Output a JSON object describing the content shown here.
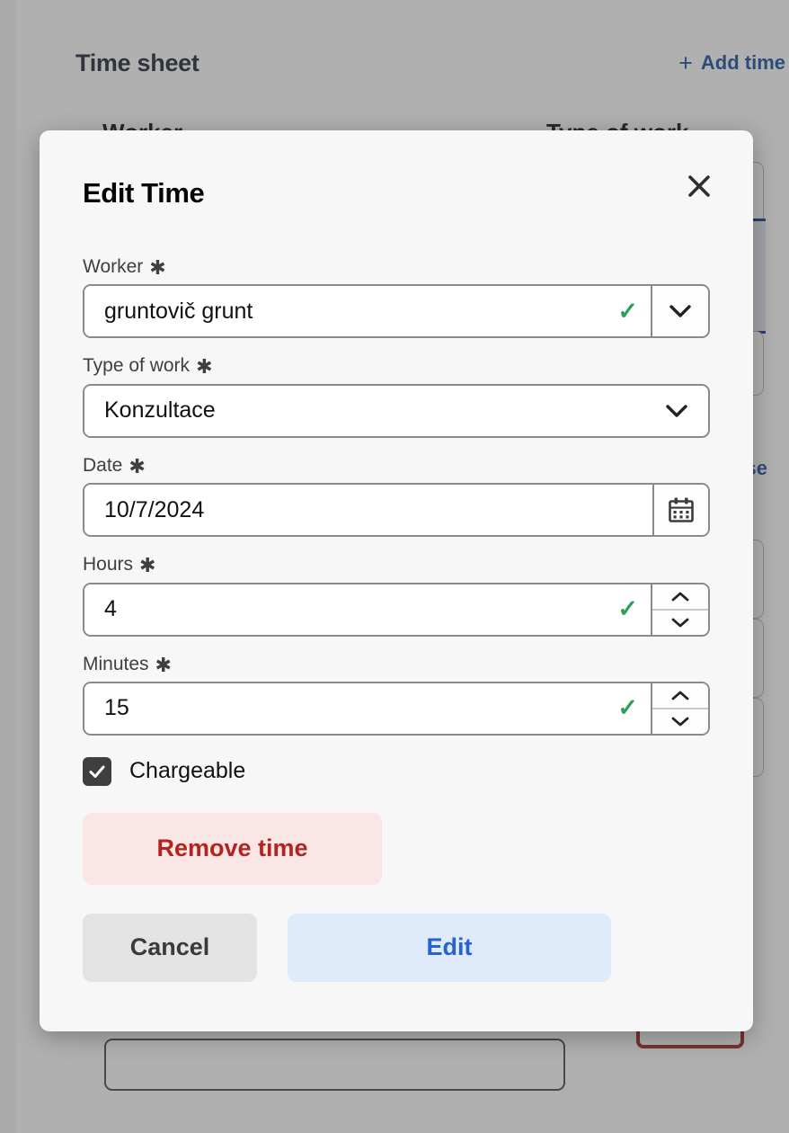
{
  "background": {
    "page_title": "Time sheet",
    "add_time_label": "Add time",
    "add_time_icon": "plus-icon",
    "columns": [
      "Worker",
      "Type of work"
    ],
    "link_text": "se",
    "rows": [
      {
        "state": "normal"
      },
      {
        "state": "selected"
      },
      {
        "state": "normal"
      },
      {
        "state": "normal"
      },
      {
        "state": "normal"
      },
      {
        "state": "normal"
      }
    ],
    "accent_blue": "#1c4fa1",
    "selected_row_border": "#12398e",
    "selected_row_fill": "#e3e8f2"
  },
  "modal": {
    "title": "Edit Time",
    "close_icon": "close-icon",
    "fields": {
      "worker": {
        "label": "Worker",
        "required_mark": "✱",
        "value": "gruntovič grunt",
        "valid_icon": "check-icon",
        "dropdown_icon": "chevron-down-icon"
      },
      "type_of_work": {
        "label": "Type of work",
        "required_mark": "✱",
        "value": "Konzultace",
        "dropdown_icon": "chevron-down-icon"
      },
      "date": {
        "label": "Date",
        "required_mark": "✱",
        "value": "10/7/2024",
        "calendar_icon": "calendar-icon"
      },
      "hours": {
        "label": "Hours",
        "required_mark": "✱",
        "value": "4",
        "valid_icon": "check-icon",
        "increment_icon": "chevron-up-icon",
        "decrement_icon": "chevron-down-icon"
      },
      "minutes": {
        "label": "Minutes",
        "required_mark": "✱",
        "value": "15",
        "valid_icon": "check-icon",
        "increment_icon": "chevron-up-icon",
        "decrement_icon": "chevron-down-icon"
      },
      "chargeable": {
        "label": "Chargeable",
        "checked": true,
        "check_icon": "check-icon"
      }
    },
    "buttons": {
      "remove": "Remove time",
      "cancel": "Cancel",
      "submit": "Edit"
    },
    "colors": {
      "remove_bg": "#fbe6e6",
      "remove_text": "#b4231f",
      "cancel_bg": "#e3e3e3",
      "cancel_text": "#3a3a3a",
      "submit_bg": "#dfeafb",
      "submit_text": "#2563d4",
      "valid_check": "#2e9e5b",
      "checkbox_bg": "#3f3f3f"
    }
  }
}
